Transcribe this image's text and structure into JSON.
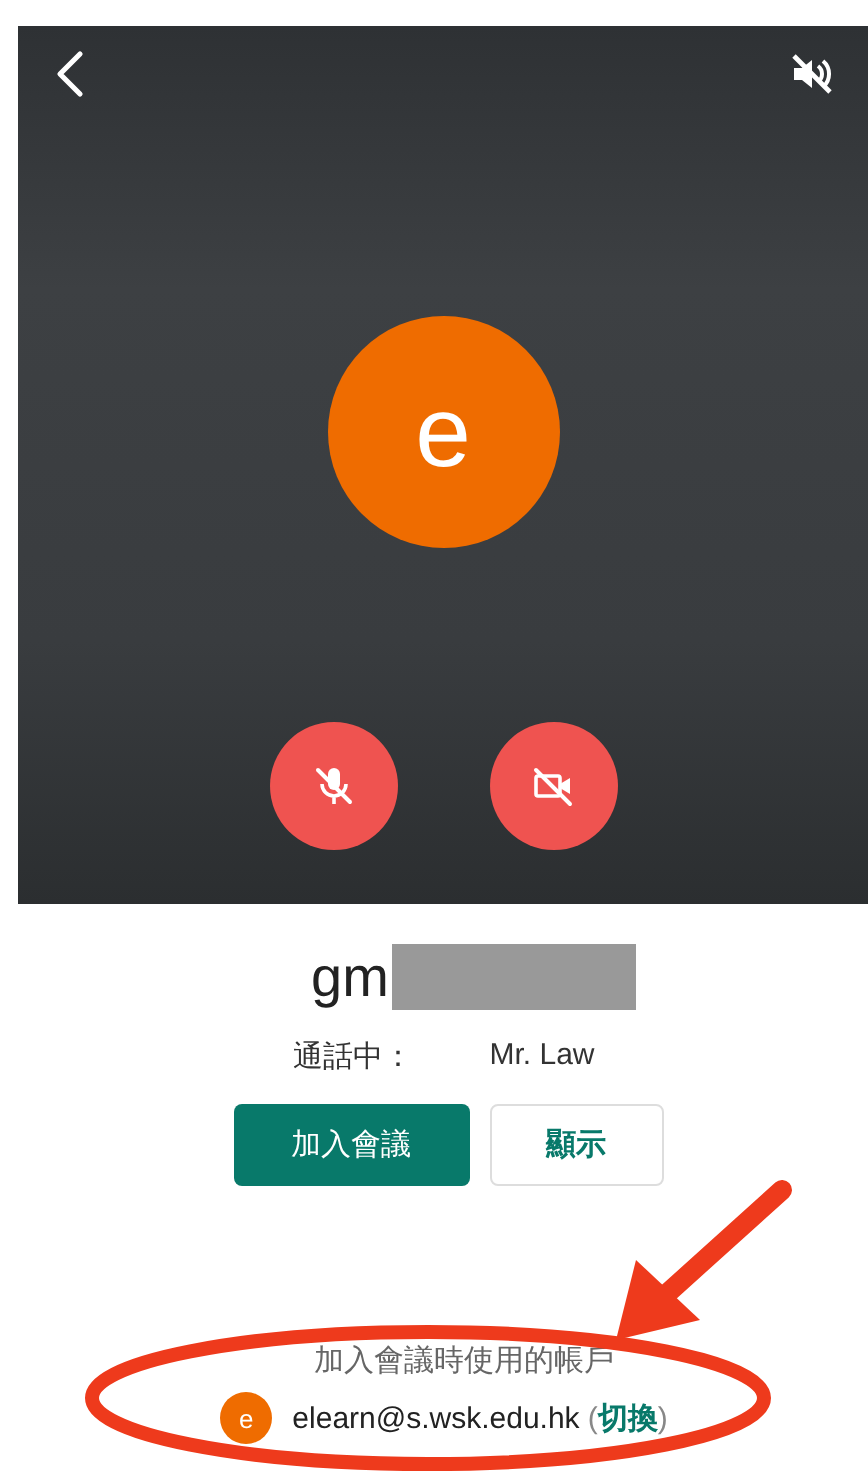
{
  "preview": {
    "avatar_letter": "e",
    "controls": [
      {
        "kind": "mic",
        "on": false
      },
      {
        "kind": "camera",
        "on": false
      }
    ],
    "speaker_muted": true
  },
  "meeting": {
    "code": "gm",
    "code_redacted": true,
    "status_label": "通話中：",
    "participant": "Mr. Law"
  },
  "buttons": [
    {
      "kind": "primary",
      "label": "加入會議"
    },
    {
      "kind": "secondary",
      "label": "顯示"
    }
  ],
  "account": {
    "caption": "加入會議時使用的帳戶",
    "avatar_letter": "e",
    "email": "elearn@s.wsk.edu.hk",
    "switch_open": "(",
    "switch_link": "切換",
    "switch_close": ")"
  },
  "annotation": {
    "kind": "arrow-circle",
    "color": "#ee3a1c"
  }
}
